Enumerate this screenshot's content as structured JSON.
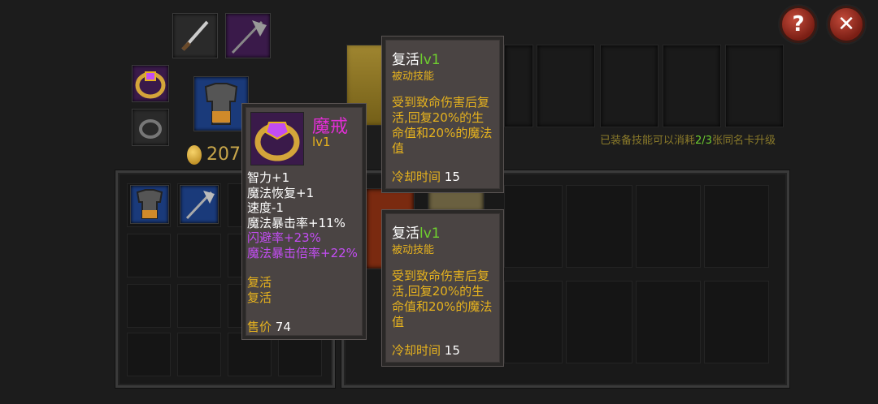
{
  "header": {
    "help_icon": "question-mark",
    "close_icon": "x-mark"
  },
  "equipment": {
    "slots": [
      {
        "name": "dagger",
        "icon": "dagger-icon"
      },
      {
        "name": "axe",
        "icon": "axe-icon"
      },
      {
        "name": "ring",
        "icon": "purple-ring-icon"
      },
      {
        "name": "armor",
        "icon": "chestplate-icon"
      },
      {
        "name": "ring2",
        "icon": "iron-ring-icon"
      }
    ],
    "gold_amount": "207"
  },
  "skills": {
    "upgrade_hint_prefix": "已装备技能可以消耗",
    "upgrade_hint_count": "2/3",
    "upgrade_hint_suffix": "张同名卡升级"
  },
  "item_tooltip": {
    "name": "魔戒",
    "level": "lv1",
    "stats": [
      "智力+1",
      "魔法恢复+1",
      "速度-1",
      "魔法暴击率+11%"
    ],
    "special_stats": [
      "闪避率+23%",
      "魔法暴击倍率+22%"
    ],
    "skills": [
      "复活",
      "复活"
    ],
    "price_label": "售价",
    "price_value": "74"
  },
  "skill_tooltip_1": {
    "name": "复活",
    "level": "lv1",
    "type": "被动技能",
    "description": "受到致命伤害后复活,回复20%的生命值和20%的魔法值",
    "cooldown_label": "冷却时间",
    "cooldown_value": "15"
  },
  "skill_tooltip_2": {
    "name": "复活",
    "level": "lv1",
    "type": "被动技能",
    "description": "受到致命伤害后复活,回复20%的生命值和20%的魔法值",
    "cooldown_label": "冷却时间",
    "cooldown_value": "15"
  },
  "colors": {
    "gold": "#e6b21e",
    "purple": "#c24df2",
    "green": "#6fcf2f",
    "magenta": "#e22ed6"
  }
}
